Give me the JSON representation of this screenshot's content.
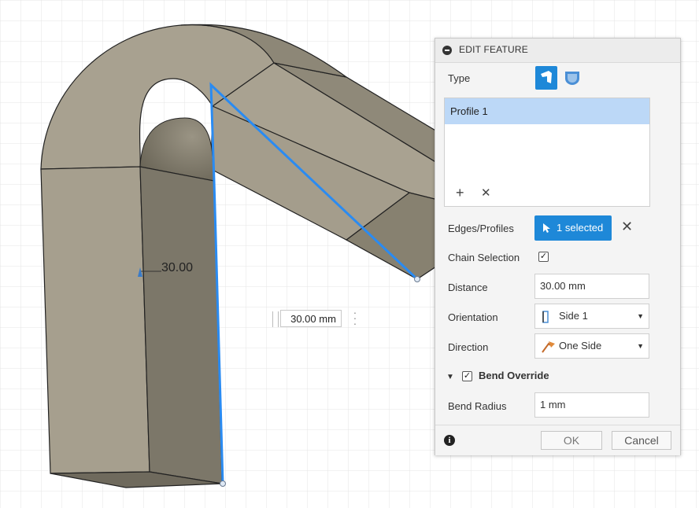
{
  "viewport": {
    "dimension_label": "30.00",
    "inline_input_value": "30.00 mm"
  },
  "panel": {
    "title": "EDIT FEATURE",
    "type_label": "Type",
    "profiles": [
      "Profile 1"
    ],
    "edges_profiles_label": "Edges/Profiles",
    "edges_selected": "1 selected",
    "chain_selection_label": "Chain Selection",
    "chain_selection_checked": true,
    "distance_label": "Distance",
    "distance_value": "30.00 mm",
    "orientation_label": "Orientation",
    "orientation_value": "Side 1",
    "direction_label": "Direction",
    "direction_value": "One Side",
    "bend_override_label": "Bend Override",
    "bend_override_checked": true,
    "bend_radius_label": "Bend Radius",
    "bend_radius_value": "1 mm",
    "ok_label": "OK",
    "cancel_label": "Cancel"
  },
  "colors": {
    "accent": "#1e88d8",
    "selection_line": "#2a8bf2",
    "solid_face": "#a69f8e",
    "grid": "#e3e3e3"
  }
}
